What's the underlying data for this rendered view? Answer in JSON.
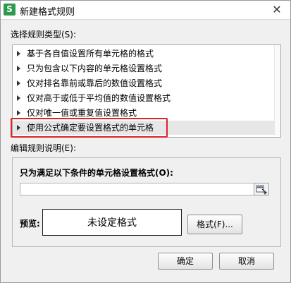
{
  "window": {
    "icon_text": "S",
    "title": "新建格式规则",
    "close_glyph": "✕"
  },
  "rule_type_label": "选择规则类型(S):",
  "rule_types": [
    "基于各自值设置所有单元格的格式",
    "只为包含以下内容的单元格设置格式",
    "仅对排名靠前或靠后的数值设置格式",
    "仅对高于或低于平均值的数值设置格式",
    "仅对唯一值或重复值设置格式",
    "使用公式确定要设置格式的单元格"
  ],
  "selected_rule_index": 5,
  "edit_label": "编辑规则说明(E):",
  "edit": {
    "condition_label": "只为满足以下条件的单元格设置格式(O):",
    "formula_value": "",
    "preview_label": "预览:",
    "preview_text": "未设定格式",
    "format_button": "格式(F)..."
  },
  "buttons": {
    "ok": "确定",
    "cancel": "取消"
  },
  "icons": {
    "app": "wps-spreadsheet-icon",
    "close": "close-icon",
    "expand": "triangle-right-icon",
    "range_select": "range-select-icon"
  },
  "colors": {
    "highlight": "#d9262a",
    "app_icon": "#2e9a4f"
  }
}
